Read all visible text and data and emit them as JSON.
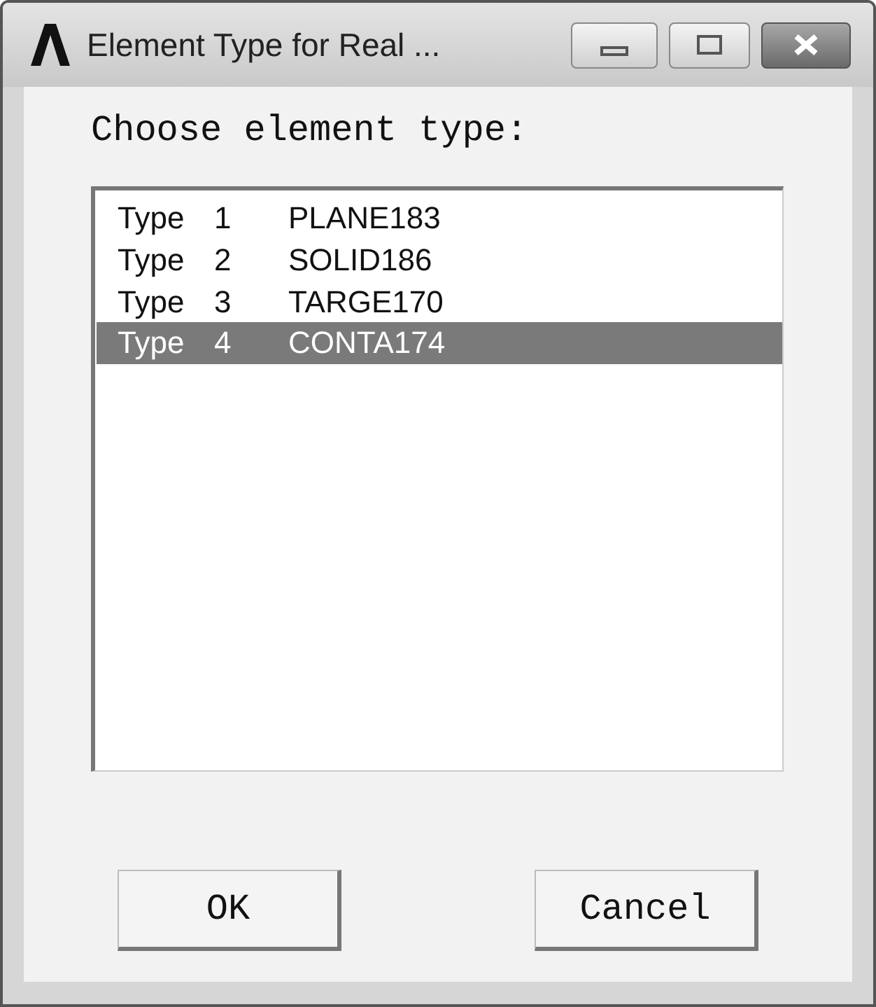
{
  "window": {
    "title": "Element Type for Real ..."
  },
  "prompt": "Choose element type:",
  "list": {
    "rows": [
      {
        "label": "Type",
        "number": "1",
        "name": "PLANE183",
        "selected": false
      },
      {
        "label": "Type",
        "number": "2",
        "name": "SOLID186",
        "selected": false
      },
      {
        "label": "Type",
        "number": "3",
        "name": "TARGE170",
        "selected": false
      },
      {
        "label": "Type",
        "number": "4",
        "name": "CONTA174",
        "selected": true
      }
    ]
  },
  "buttons": [
    "OK",
    "Cancel"
  ]
}
